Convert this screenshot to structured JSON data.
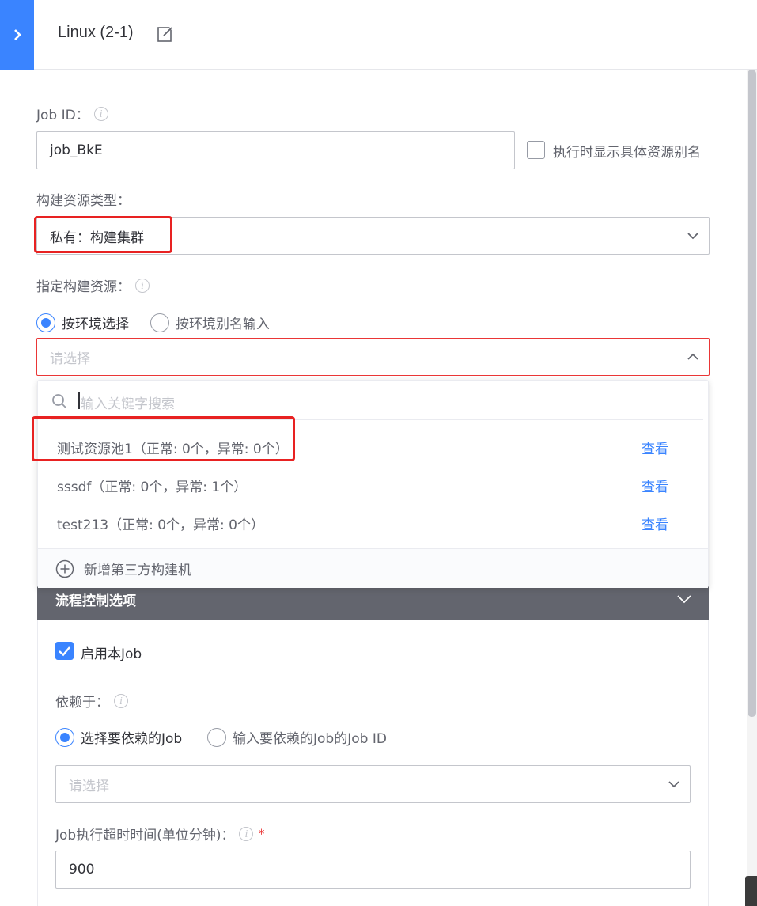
{
  "header": {
    "title": "Linux (2-1)",
    "expand_icon": "chevron-right-icon",
    "edit_icon": "edit-icon"
  },
  "job_id": {
    "label": "Job ID：",
    "value": "job_BkE",
    "show_alias_label": "执行时显示具体资源别名",
    "show_alias_checked": false
  },
  "resource_type": {
    "label": "构建资源类型：",
    "value": "私有：构建集群"
  },
  "resource": {
    "label": "指定构建资源：",
    "radio_env": "按环境选择",
    "radio_alias": "按环境别名输入",
    "selected_radio": "按环境选择",
    "placeholder": "请选择",
    "search_placeholder": "输入关键字搜索",
    "options": [
      {
        "name": "测试资源池1（正常: 0个，异常: 0个）",
        "action": "查看"
      },
      {
        "name": "sssdf（正常: 0个，异常: 1个）",
        "action": "查看"
      },
      {
        "name": "test213（正常: 0个，异常: 0个）",
        "action": "查看"
      }
    ],
    "add_label": "新增第三方构建机"
  },
  "flow_control": {
    "title": "流程控制选项",
    "enable_label": "启用本Job",
    "enable_checked": true,
    "depends_label": "依赖于：",
    "radio_select": "选择要依赖的Job",
    "radio_input": "输入要依赖的Job的Job ID",
    "selected_radio": "选择要依赖的Job",
    "depends_placeholder": "请选择",
    "timeout_label": "Job执行超时时间(单位分钟)：",
    "timeout_required": "*",
    "timeout_value": "900"
  },
  "colors": {
    "primary": "#3a84ff",
    "highlight_box": "#e82222",
    "section_bar": "#63656e"
  }
}
